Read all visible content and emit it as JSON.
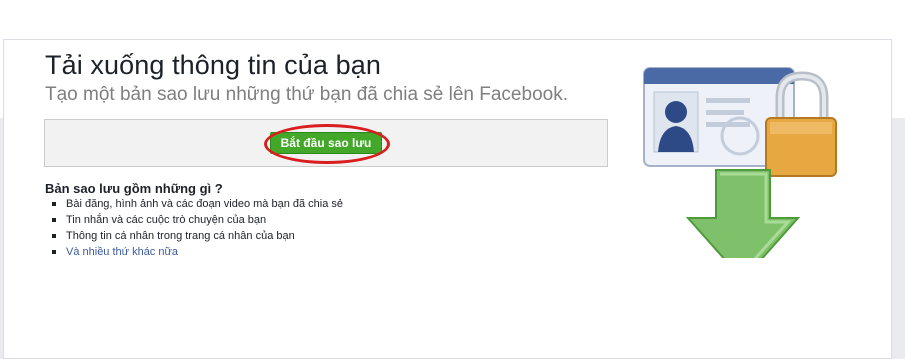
{
  "page": {
    "title": "Tải xuống thông tin của bạn",
    "subtitle": "Tạo một bản sao lưu những thứ bạn đã chia sẻ lên Facebook."
  },
  "action": {
    "start_button_label": "Bắt đầu sao lưu"
  },
  "includes": {
    "heading": "Bản sao lưu gồm những gì ?",
    "items": [
      "Bài đăng, hình ảnh và các đoạn video mà bạn đã chia sẻ",
      "Tin nhắn và các cuộc trò chuyện của bạn",
      "Thông tin cá nhân trong trang cá nhân của bạn"
    ],
    "more_link": "Và nhiều thứ khác nữa"
  },
  "illustration": {
    "icons": [
      "id-card-icon",
      "padlock-icon",
      "download-arrow-icon"
    ]
  },
  "colors": {
    "button_green": "#43a82a",
    "highlight_red": "#d81e1e",
    "link_blue": "#3b5998",
    "arrow_green": "#7fc16a",
    "lock_gold": "#e7a841"
  }
}
